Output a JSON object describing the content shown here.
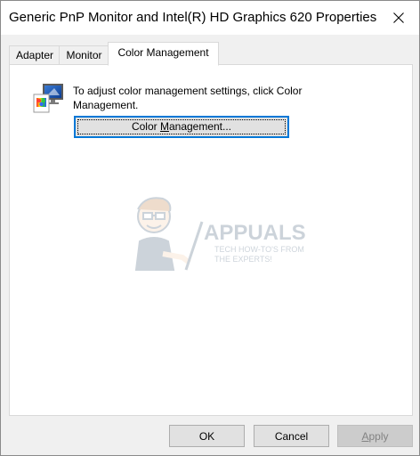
{
  "window": {
    "title": "Generic PnP Monitor and Intel(R) HD Graphics 620 Properties"
  },
  "tabs": [
    {
      "label": "Adapter"
    },
    {
      "label": "Monitor"
    },
    {
      "label": "Color Management",
      "active": true
    }
  ],
  "color_management": {
    "description": "To adjust color management settings, click Color Management.",
    "button_label_pre": "Color ",
    "button_label_accel": "M",
    "button_label_post": "anagement..."
  },
  "watermark": {
    "brand": "APPUALS",
    "tagline_1": "TECH HOW-TO'S FROM",
    "tagline_2": "THE EXPERTS!"
  },
  "footer": {
    "ok_label": "OK",
    "cancel_label": "Cancel",
    "apply_pre": "",
    "apply_accel": "A",
    "apply_post": "pply"
  },
  "colors": {
    "focus_border": "#0078d7",
    "button_face": "#e1e1e1",
    "disabled_text": "#838383"
  },
  "icons": {
    "close": "close-icon",
    "color_management": "color-management-icon"
  }
}
